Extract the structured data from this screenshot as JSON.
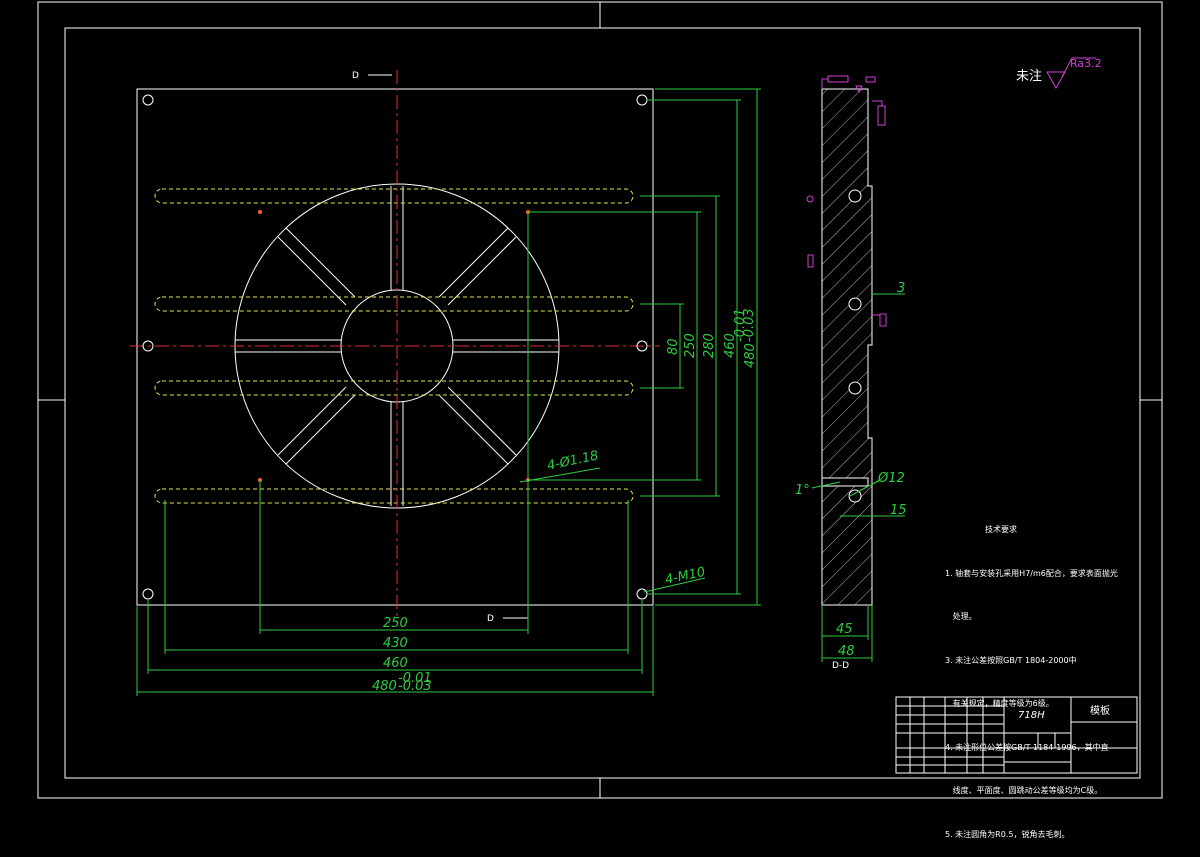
{
  "section_marks": {
    "top": "D",
    "bottom": "D",
    "section_label": "D-D"
  },
  "dimensions": {
    "horizontal": [
      "250",
      "430",
      "460",
      "480"
    ],
    "horizontal_tol": {
      "upper": "-0.01",
      "lower": "-0.03"
    },
    "vertical": [
      "80",
      "250",
      "280",
      "460",
      "480"
    ],
    "vertical_tol": {
      "upper": "-0.01",
      "lower": "-0.03"
    },
    "callouts": [
      "4-Ø1.18",
      "4-M10"
    ],
    "side": [
      "3",
      "1°",
      "Ø12",
      "15",
      "45",
      "48"
    ]
  },
  "roughness": {
    "label": "未注",
    "value": "Ra3.2"
  },
  "tech_requirements": {
    "title": "技术要求",
    "items": [
      "1. 轴套与安装孔采用H7/m6配合，要求表面抛光",
      "   处理。",
      "3. 未注公差按照GB/T 1804-2000中",
      "   有关规定，精度等级为6级。",
      "4. 未注形位公差按GB/T 1184-1996，其中直",
      "   线度、平面度、圆跳动公差等级均为C级。",
      "5. 未注圆角为R0.5，锐角去毛刺。"
    ]
  },
  "title_block": {
    "material": "718H",
    "part_name": "模板"
  },
  "colors": {
    "geometry": "#ffffff",
    "dimension": "#2ecc40",
    "hidden": "#e6e64a",
    "center": "#e03030",
    "annotation": "#d040d0"
  }
}
